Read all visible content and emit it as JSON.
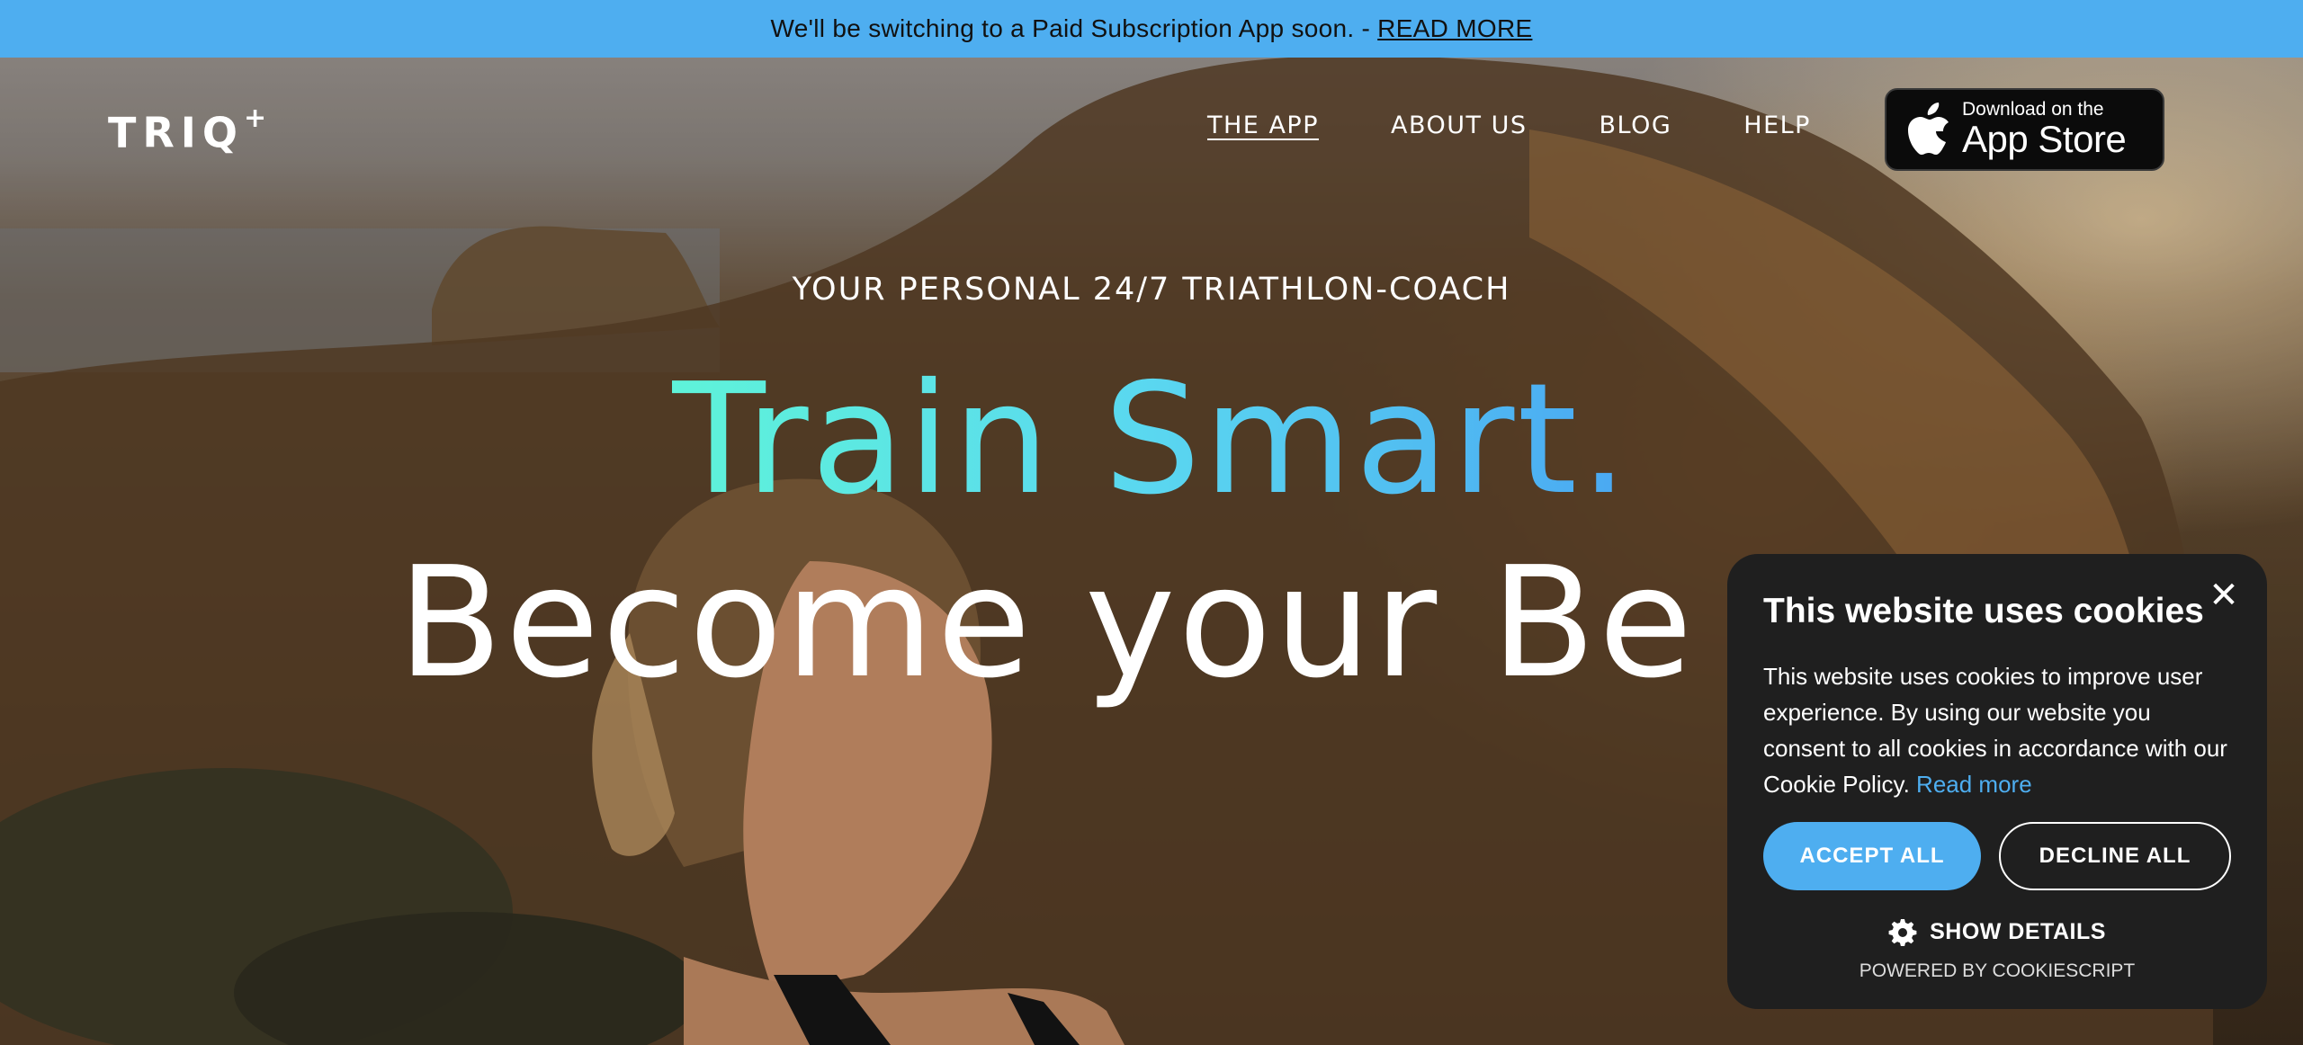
{
  "announcement": {
    "text": "We'll be switching to a Paid Subscription App soon. -",
    "link": "READ MORE",
    "bg_color": "#4eaef0"
  },
  "header": {
    "logo": "TRIQ",
    "logo_sup": "+",
    "nav": [
      {
        "label": "THE APP",
        "active": true
      },
      {
        "label": "ABOUT US",
        "active": false
      },
      {
        "label": "BLOG",
        "active": false
      },
      {
        "label": "HELP",
        "active": false
      }
    ],
    "appstore": {
      "small": "Download on the",
      "big": "App Store",
      "icon": "apple-icon"
    }
  },
  "hero": {
    "kicker": "YOUR PERSONAL 24/7 TRIATHLON-COACH",
    "headline_1": "Train Smart.",
    "headline_2": "Become your Be",
    "gradient_colors": [
      "#5ef3d9",
      "#4aa8f2"
    ]
  },
  "cookie_banner": {
    "title": "This website uses cookies",
    "body": "This website uses cookies to improve user experience. By using our website you consent to all cookies in accordance with our Cookie Policy.",
    "read_more": "Read more",
    "accept": "ACCEPT ALL",
    "decline": "DECLINE ALL",
    "show_details": "SHOW DETAILS",
    "powered_by": "POWERED BY COOKIESCRIPT",
    "close_icon": "close-icon",
    "gear_icon": "gear-icon",
    "accent_color": "#4eaef0"
  }
}
